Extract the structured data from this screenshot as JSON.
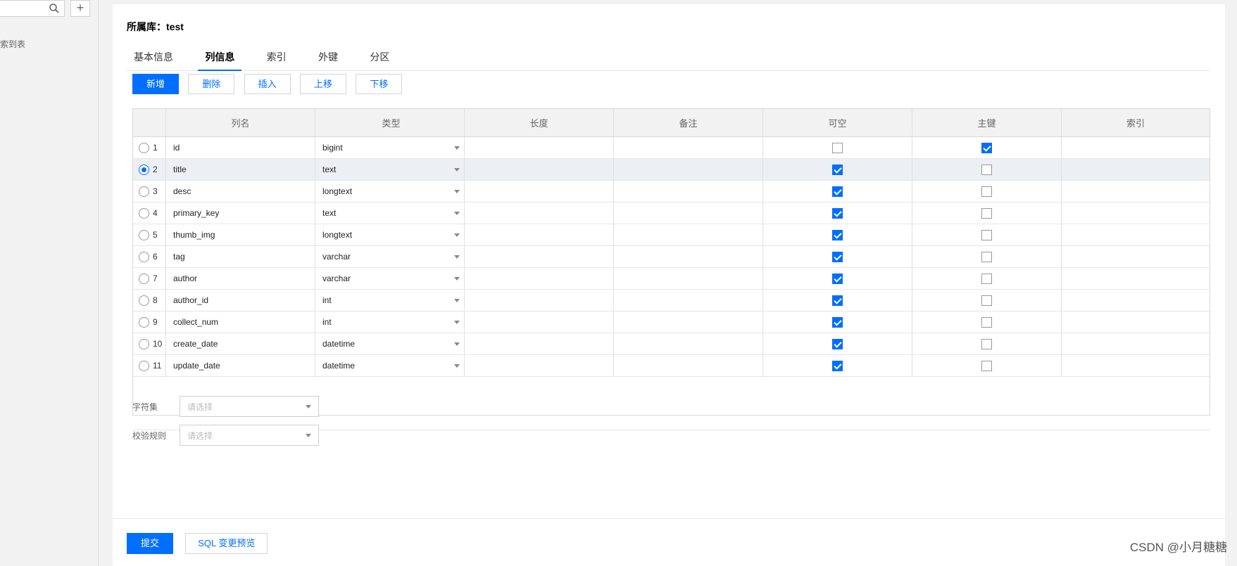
{
  "sidebar": {
    "search_placeholder": "",
    "add_label": "+",
    "hint": "索到表"
  },
  "database": {
    "label": "所属库：test"
  },
  "tabs": [
    {
      "label": "基本信息",
      "active": false
    },
    {
      "label": "列信息",
      "active": true
    },
    {
      "label": "索引",
      "active": false
    },
    {
      "label": "外键",
      "active": false
    },
    {
      "label": "分区",
      "active": false
    }
  ],
  "toolbar": {
    "add": "新增",
    "delete": "删除",
    "insert": "插入",
    "move_up": "上移",
    "move_down": "下移"
  },
  "columns_table": {
    "headers": [
      "列名",
      "类型",
      "长度",
      "备注",
      "可空",
      "主键",
      "索引"
    ],
    "selected_row": 2,
    "rows": [
      {
        "num": "1",
        "name": "id",
        "type": "bigint",
        "length": "",
        "comment": "",
        "nullable": false,
        "primary": true,
        "index": ""
      },
      {
        "num": "2",
        "name": "title",
        "type": "text",
        "length": "",
        "comment": "",
        "nullable": true,
        "primary": false,
        "index": ""
      },
      {
        "num": "3",
        "name": "desc",
        "type": "longtext",
        "length": "",
        "comment": "",
        "nullable": true,
        "primary": false,
        "index": ""
      },
      {
        "num": "4",
        "name": "primary_key",
        "type": "text",
        "length": "",
        "comment": "",
        "nullable": true,
        "primary": false,
        "index": ""
      },
      {
        "num": "5",
        "name": "thumb_img",
        "type": "longtext",
        "length": "",
        "comment": "",
        "nullable": true,
        "primary": false,
        "index": ""
      },
      {
        "num": "6",
        "name": "tag",
        "type": "varchar",
        "length": "",
        "comment": "",
        "nullable": true,
        "primary": false,
        "index": ""
      },
      {
        "num": "7",
        "name": "author",
        "type": "varchar",
        "length": "",
        "comment": "",
        "nullable": true,
        "primary": false,
        "index": ""
      },
      {
        "num": "8",
        "name": "author_id",
        "type": "int",
        "length": "",
        "comment": "",
        "nullable": true,
        "primary": false,
        "index": ""
      },
      {
        "num": "9",
        "name": "collect_num",
        "type": "int",
        "length": "",
        "comment": "",
        "nullable": true,
        "primary": false,
        "index": ""
      },
      {
        "num": "10",
        "name": "create_date",
        "type": "datetime",
        "length": "",
        "comment": "",
        "nullable": true,
        "primary": false,
        "index": ""
      },
      {
        "num": "11",
        "name": "update_date",
        "type": "datetime",
        "length": "",
        "comment": "",
        "nullable": true,
        "primary": false,
        "index": ""
      }
    ]
  },
  "options": {
    "charset_label": "字符集",
    "charset_placeholder": "请选择",
    "collation_label": "校验规则",
    "collation_placeholder": "请选择"
  },
  "footer": {
    "submit": "提交",
    "sql_preview": "SQL 变更预览"
  },
  "watermark": "CSDN @小月糖糖",
  "colors": {
    "accent": "#006eff",
    "selected_row_bg": "#eceff3"
  }
}
